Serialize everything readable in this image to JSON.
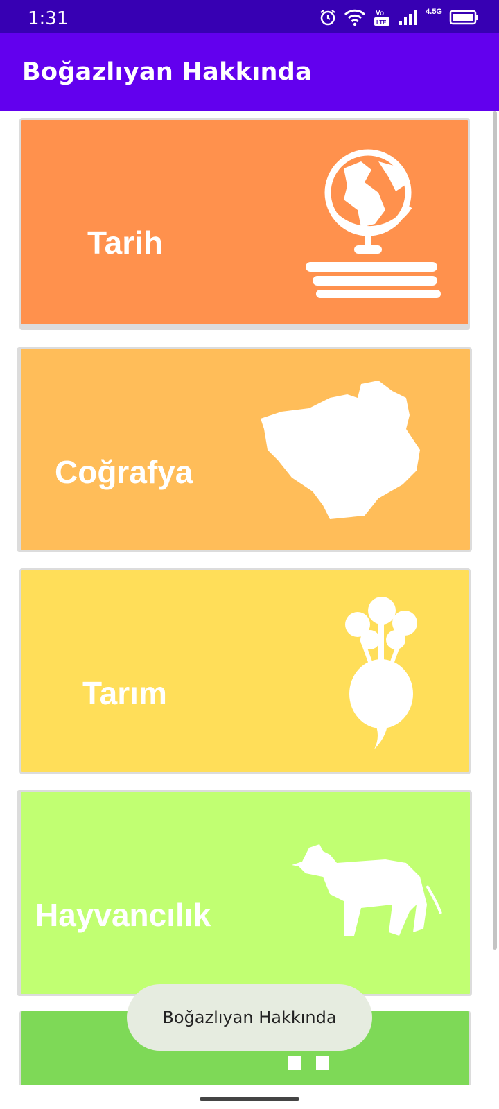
{
  "status_bar": {
    "time": "1:31",
    "network_label": "4.5G",
    "icons": [
      "alarm-icon",
      "wifi-icon",
      "volte-icon",
      "signal-icon",
      "battery-icon"
    ]
  },
  "app_bar": {
    "title": "Boğazlıyan Hakkında"
  },
  "cards": [
    {
      "label": "Tarih",
      "color": "#ff914d",
      "icon": "globe-books-icon"
    },
    {
      "label": "Coğrafya",
      "color": "#ffbd59",
      "icon": "region-map-icon"
    },
    {
      "label": "Tarım",
      "color": "#ffde59",
      "icon": "beet-icon"
    },
    {
      "label": "Hayvancılık",
      "color": "#c1ff72",
      "icon": "cow-icon"
    },
    {
      "label": "",
      "color": "#7ed957",
      "icon": "partial-icon"
    }
  ],
  "toast": {
    "text": "Boğazlıyan Hakkında"
  },
  "colors": {
    "status_bar": "#3700b3",
    "app_bar": "#6200ee"
  }
}
